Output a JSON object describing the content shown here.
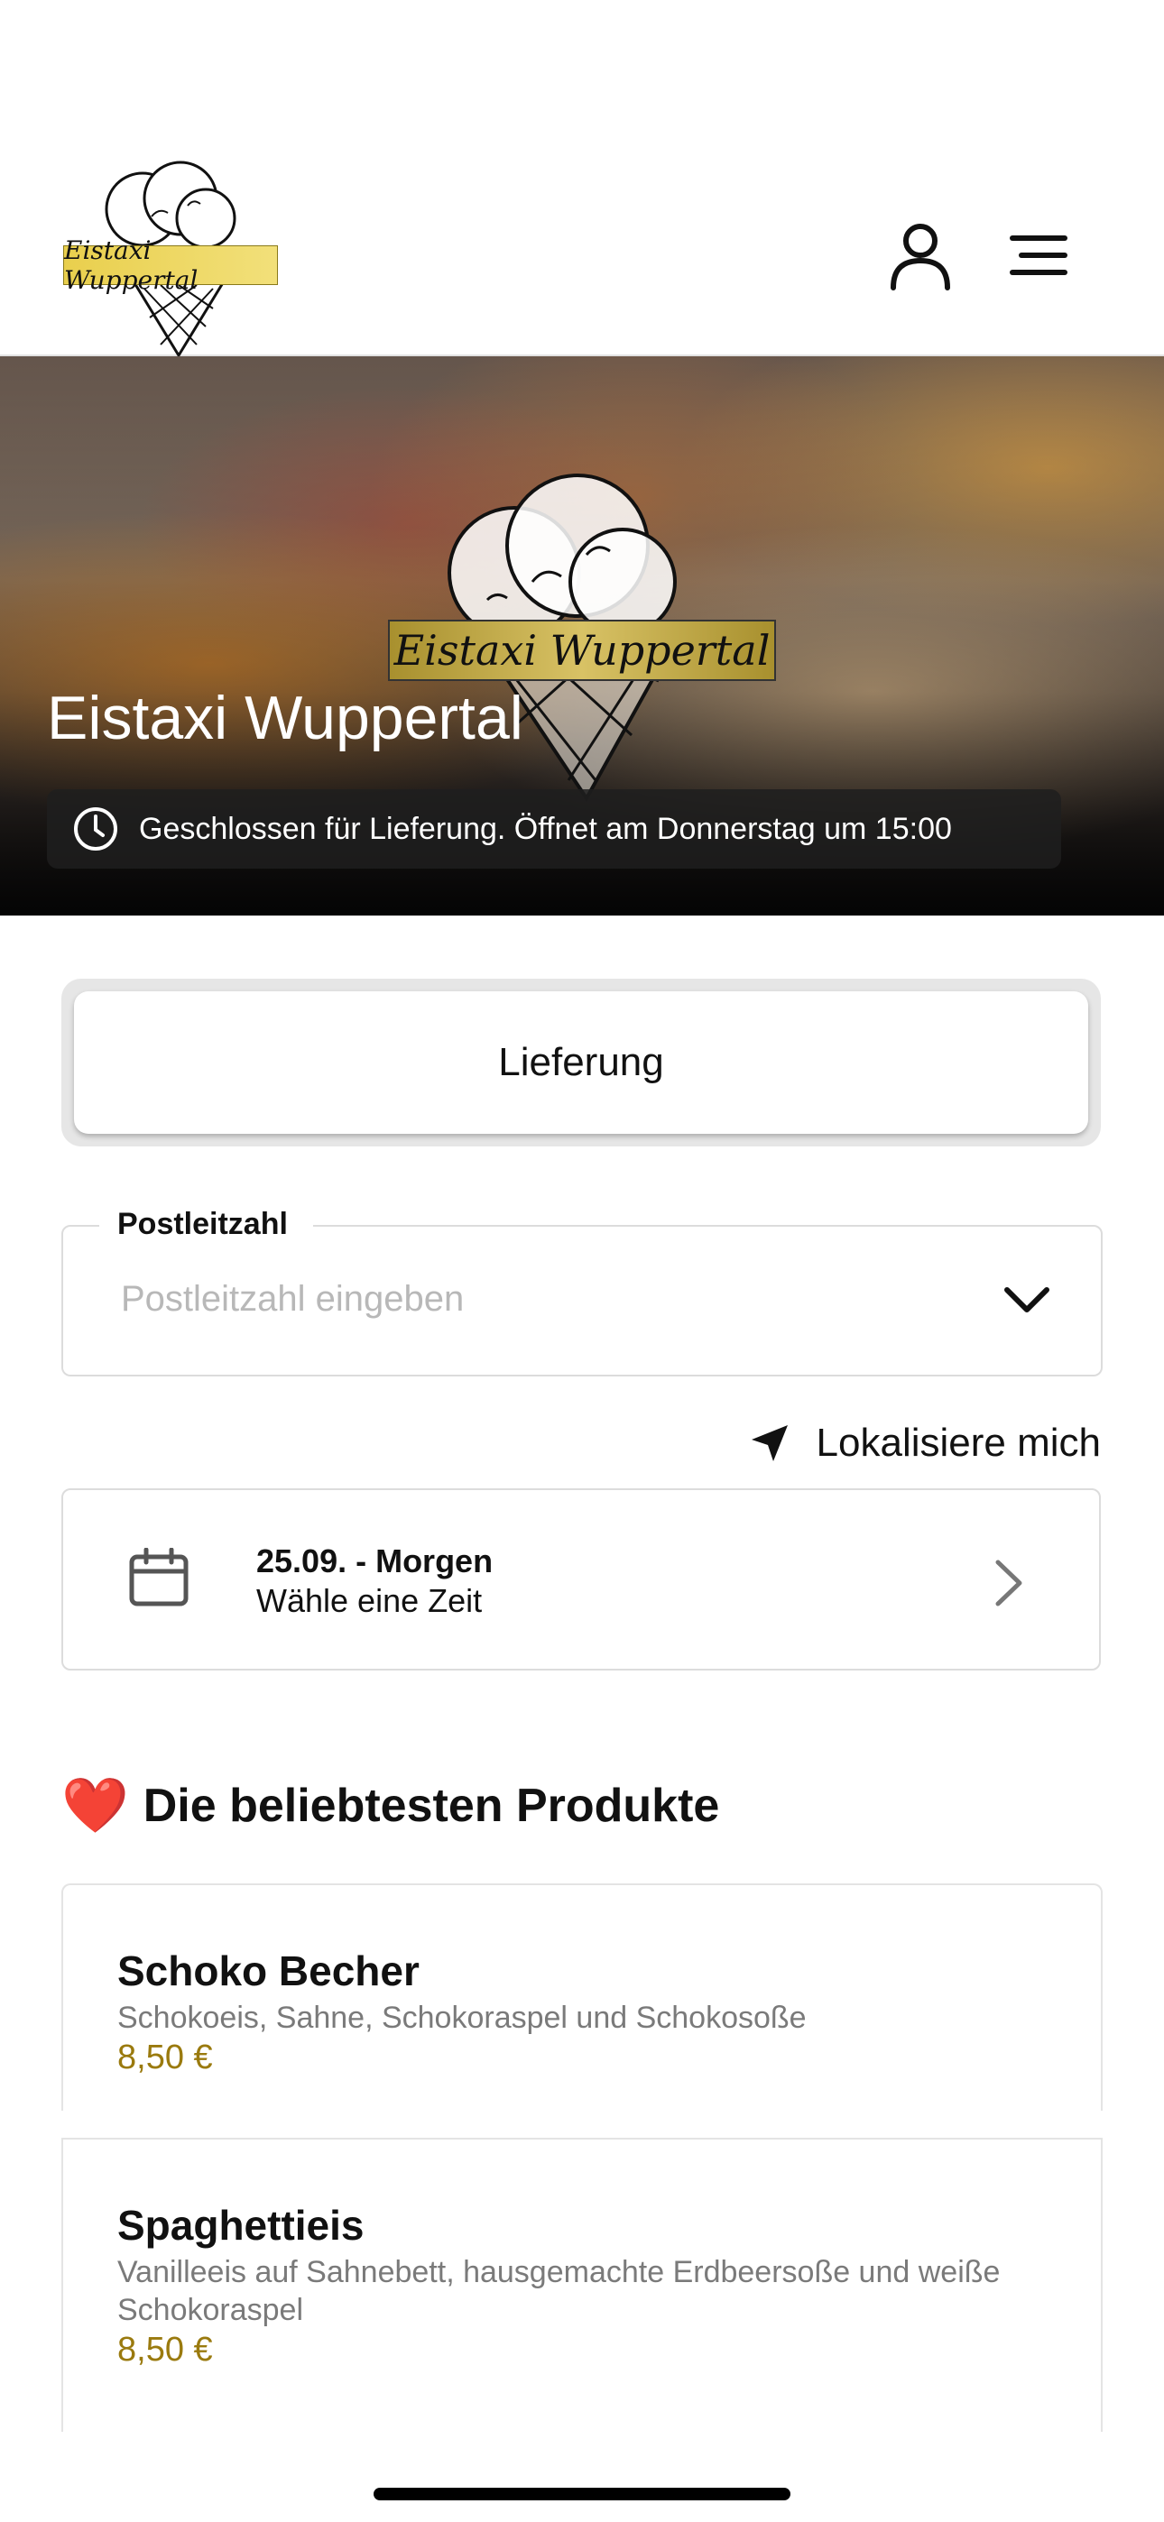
{
  "header": {
    "logo_text": "Eistaxi Wuppertal",
    "account_icon": "user-icon",
    "menu_icon": "hamburger-menu-icon"
  },
  "hero": {
    "title": "Eistaxi Wuppertal",
    "logo_text": "Eistaxi Wuppertal",
    "status_icon": "clock-icon",
    "status_text": "Geschlossen für Lieferung. Öffnet am Donnerstag um 15:00"
  },
  "order_mode": {
    "selected": "Lieferung"
  },
  "zip": {
    "label": "Postleitzahl",
    "value": "",
    "placeholder": "Postleitzahl eingeben"
  },
  "locate": {
    "label": "Lokalisiere mich",
    "icon": "location-arrow-icon"
  },
  "date_picker": {
    "title": "25.09. - Morgen",
    "subtitle": "Wähle eine Zeit",
    "icon": "calendar-icon"
  },
  "popular": {
    "emoji": "❤️",
    "title": "Die beliebtesten Produkte",
    "products": [
      {
        "name": "Schoko Becher",
        "description": "Schokoeis, Sahne, Schokoraspel und Schokosoße",
        "price": "8,50 €"
      },
      {
        "name": "Spaghettieis",
        "description": "Vanilleeis auf Sahnebett, hausgemachte Erdbeersoße und weiße Schokoraspel",
        "price": "8,50 €"
      }
    ]
  },
  "colors": {
    "price": "#9a7a0e",
    "heart": "#e0202a",
    "status_bg": "#1e1e1e"
  }
}
